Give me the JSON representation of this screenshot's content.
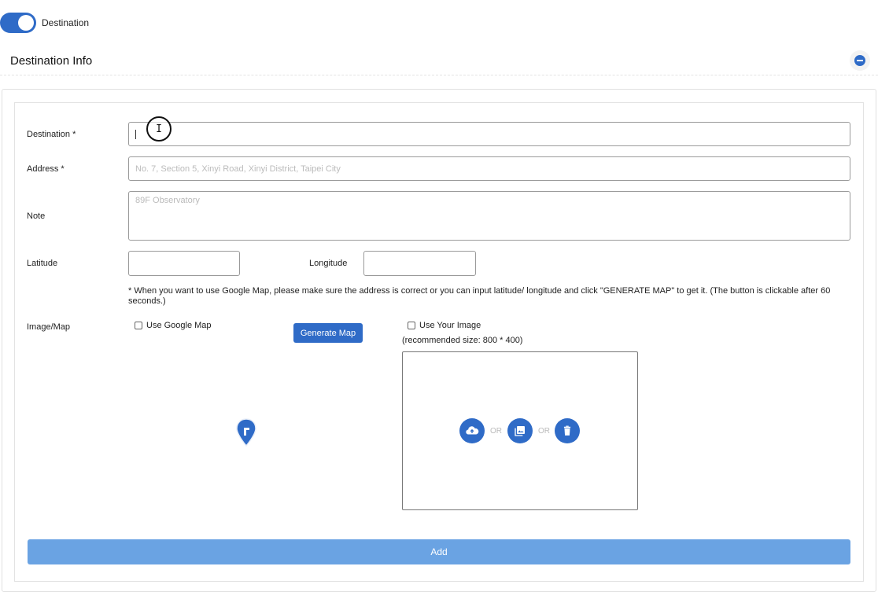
{
  "toggle": {
    "label": "Destination",
    "on": true
  },
  "section": {
    "title": "Destination Info"
  },
  "form": {
    "destination": {
      "label": "Destination *",
      "value": "",
      "placeholder": ""
    },
    "address": {
      "label": "Address *",
      "value": "",
      "placeholder": "No. 7, Section 5, Xinyi Road, Xinyi District, Taipei City"
    },
    "note": {
      "label": "Note",
      "value": "",
      "placeholder": "89F Observatory"
    },
    "latitude": {
      "label": "Latitude",
      "value": ""
    },
    "longitude": {
      "label": "Longitude",
      "value": ""
    },
    "hint": "* When you want to use Google Map, please make sure the address is correct or you can input latitude/ longitude and click \"GENERATE MAP\" to get it. (The button is clickable after 60 seconds.)",
    "image_map": {
      "label": "Image/Map",
      "use_google_map": "Use Google Map",
      "generate_map": "Generate Map",
      "use_your_image": "Use Your Image",
      "recommended": "(recommended size: 800 * 400)",
      "or1": "OR",
      "or2": "OR"
    },
    "add_button": "Add"
  },
  "colors": {
    "primary": "#2f6bc7",
    "add_button": "#6aa3e3"
  },
  "icons": [
    "map-pin-icon",
    "upload-cloud-icon",
    "image-icon",
    "trash-icon",
    "minus-circle-icon",
    "text-cursor-icon"
  ]
}
